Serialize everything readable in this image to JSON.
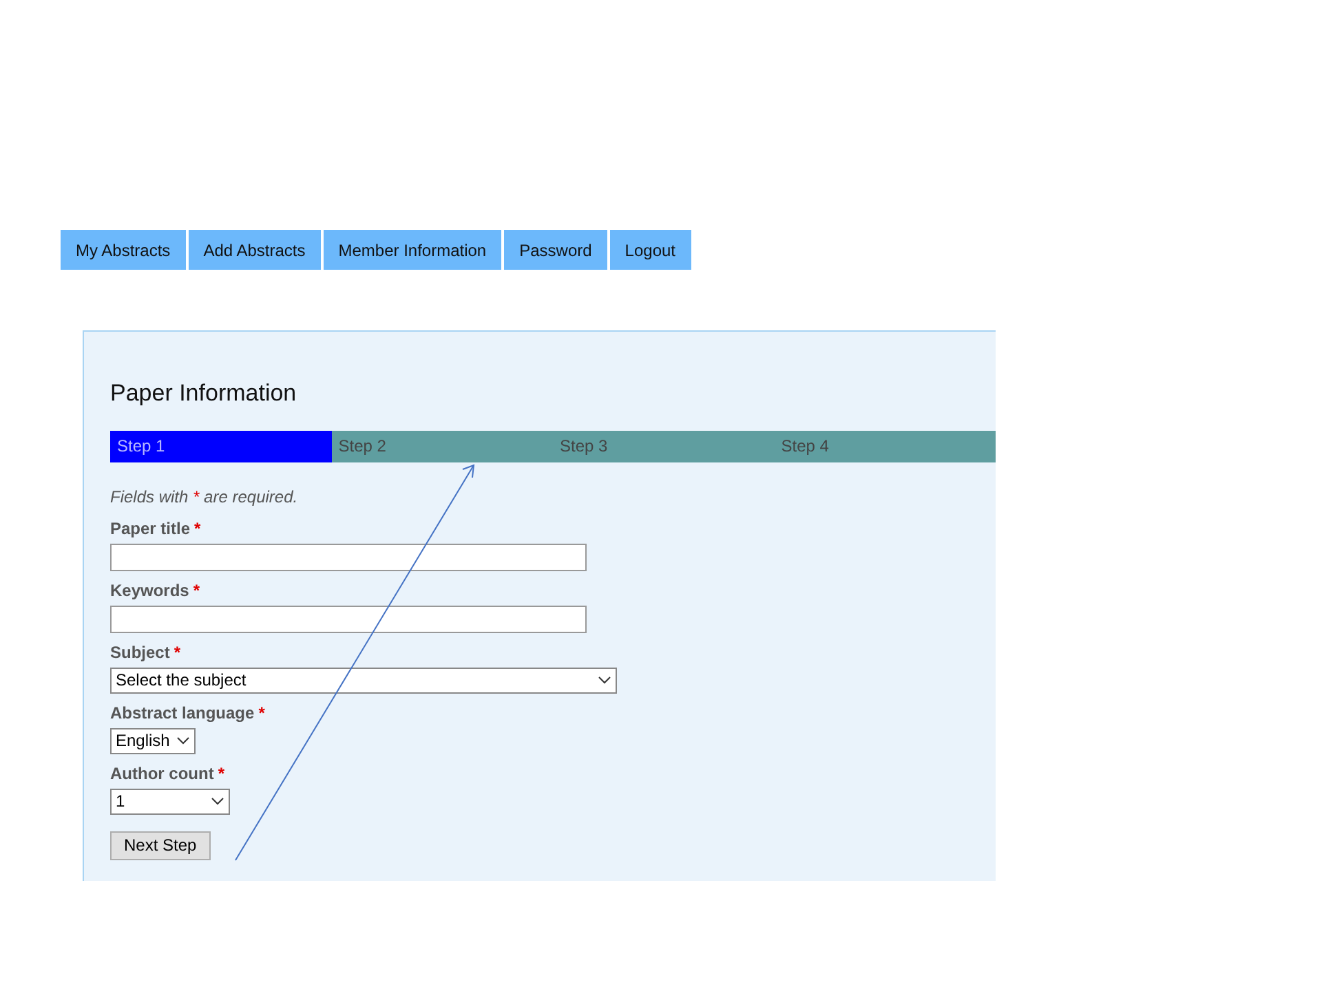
{
  "nav": [
    {
      "label": "My Abstracts"
    },
    {
      "label": "Add Abstracts"
    },
    {
      "label": "Member Information"
    },
    {
      "label": "Password"
    },
    {
      "label": "Logout"
    }
  ],
  "panel": {
    "title": "Paper Information",
    "steps": [
      {
        "label": "Step 1",
        "selected": true
      },
      {
        "label": "Step 2",
        "selected": false
      },
      {
        "label": "Step 3",
        "selected": false
      },
      {
        "label": "Step 4",
        "selected": false
      }
    ],
    "note": {
      "before": "Fields with",
      "mark": "*",
      "after": "are required."
    },
    "fields": [
      {
        "kind": "text",
        "label": "Paper title",
        "mark": "*"
      },
      {
        "kind": "text",
        "label": "Keywords",
        "mark": "*"
      },
      {
        "kind": "select",
        "label": "Subject",
        "mark": "*",
        "value": "Select the subject"
      },
      {
        "kind": "select",
        "label": "Abstract language",
        "mark": "*",
        "value": "English"
      },
      {
        "kind": "select",
        "label": "Author count",
        "mark": "*",
        "value": "1"
      }
    ],
    "button": "Next Step"
  }
}
